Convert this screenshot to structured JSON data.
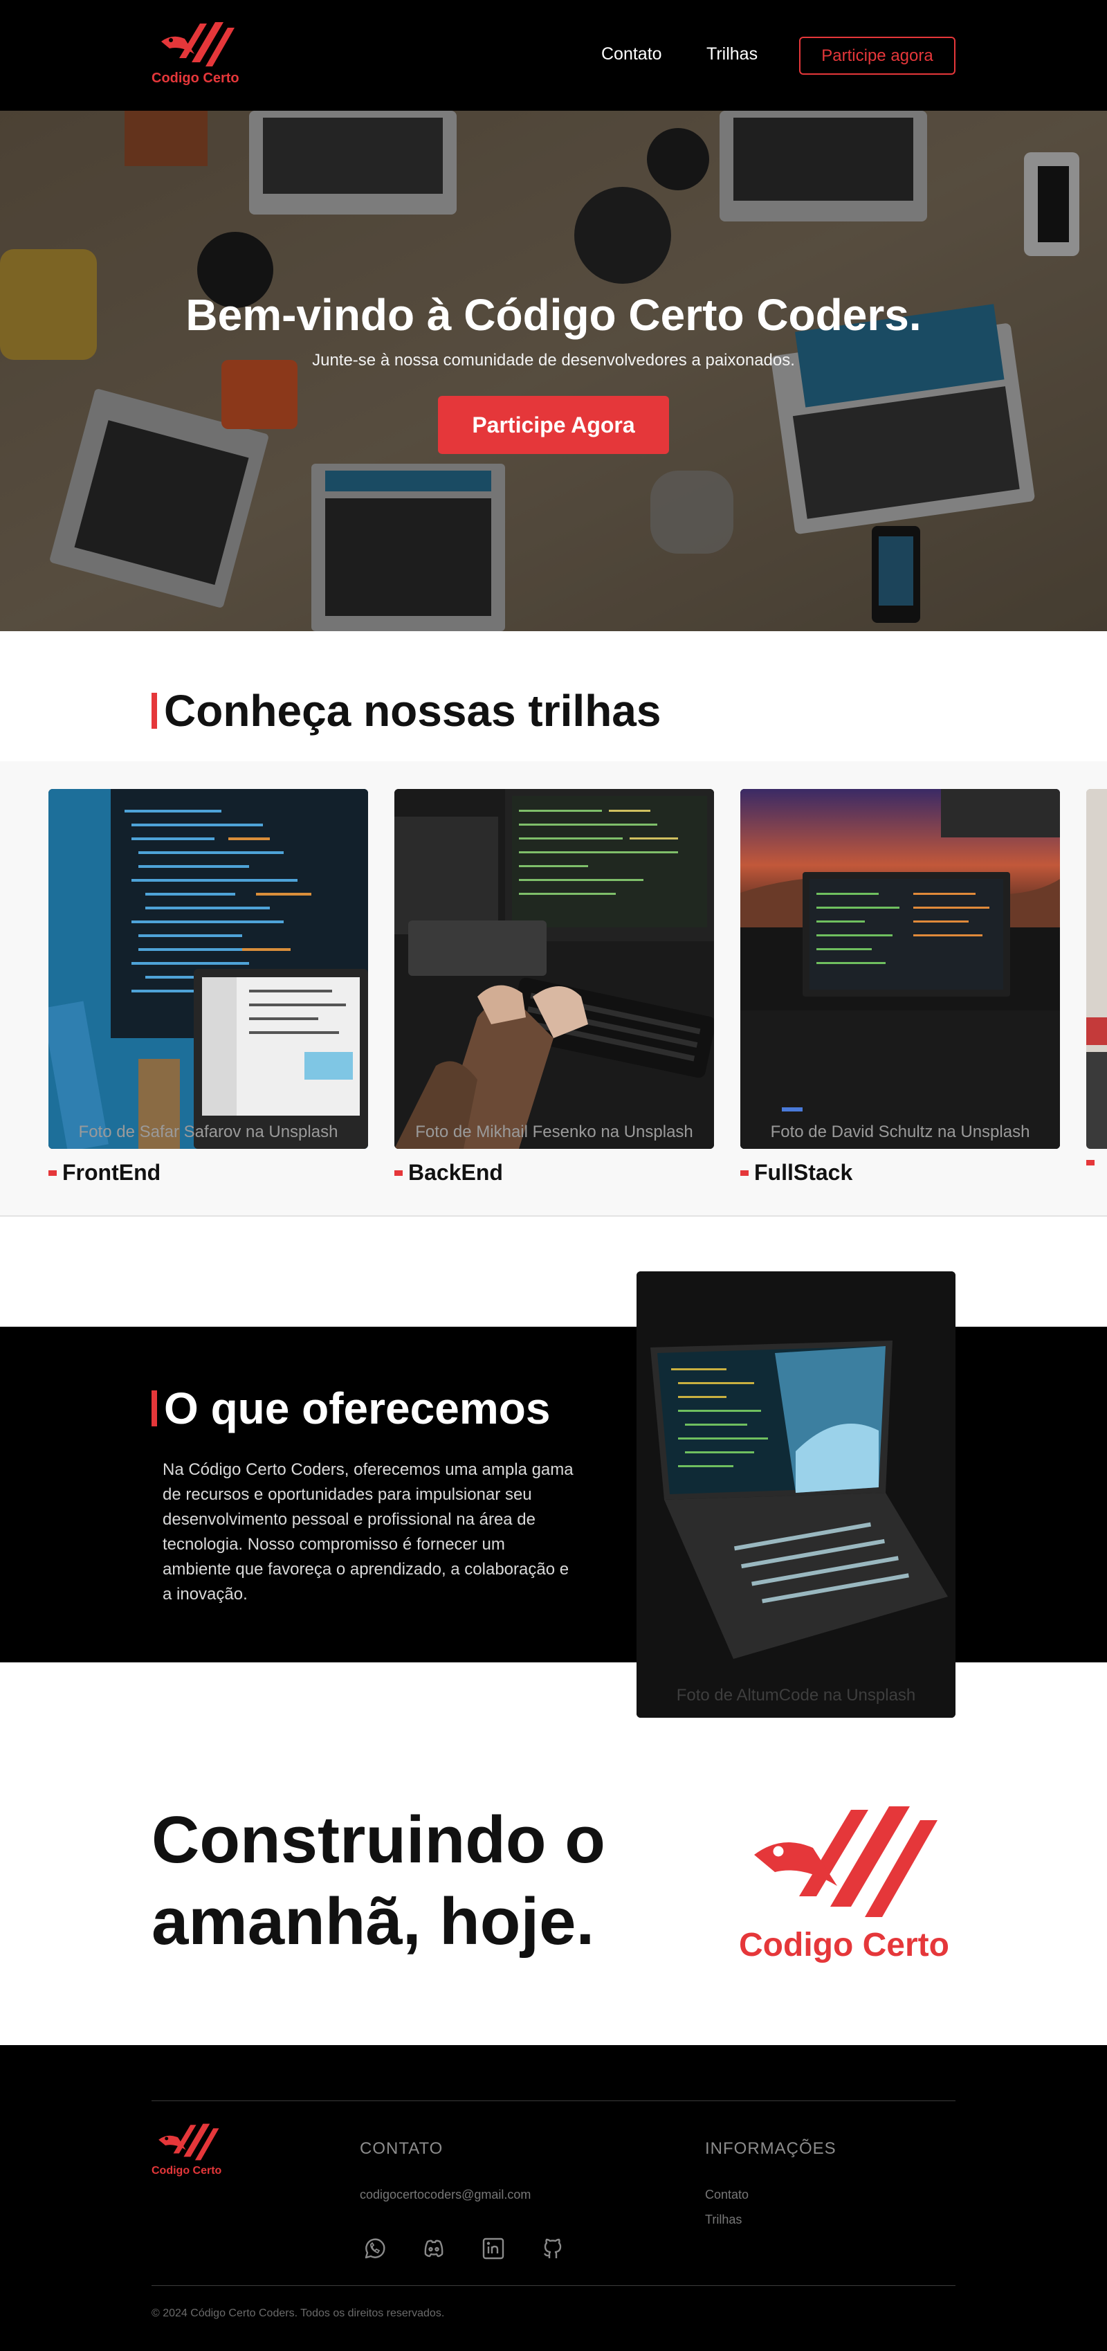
{
  "colors": {
    "brand_red": "#e5373a",
    "header_bg": "#000000",
    "footer_bg": "#000000"
  },
  "header": {
    "logo_text": "Codigo Certo",
    "nav": [
      {
        "label": "Contato"
      },
      {
        "label": "Trilhas"
      }
    ],
    "cta_label": "Participe agora"
  },
  "hero": {
    "title": "Bem-vindo à Código Certo Coders.",
    "subtitle": "Junte-se à nossa comunidade de desenvolvedores a paixonados.",
    "cta_label": "Participe Agora"
  },
  "tracks": {
    "title": "Conheça nossas trilhas",
    "items": [
      {
        "label": "FrontEnd",
        "credit": "Foto de Safar Safarov na Unsplash"
      },
      {
        "label": "BackEnd",
        "credit": "Foto de Mikhail Fesenko na Unsplash"
      },
      {
        "label": "FullStack",
        "credit": "Foto de David Schultz na Unsplash"
      }
    ]
  },
  "offer": {
    "title": "O que oferecemos",
    "text": "Na Código Certo Coders, oferecemos uma ampla gama de recursos e oportunidades para impulsionar seu desenvolvimento pessoal e profissional na área de tecnologia. Nosso compromisso é fornecer um ambiente que favoreça o aprendizado, a colaboração e a inovação.",
    "image_credit": "Foto de AltumCode na Unsplash"
  },
  "build": {
    "line1": "Construindo o",
    "line2": "amanhã, hoje.",
    "logo_text": "Codigo Certo"
  },
  "footer": {
    "logo_text": "Codigo Certo",
    "contato_heading": "CONTATO",
    "email": "codigocertocoders@gmail.com",
    "social_icons": [
      "whatsapp-icon",
      "discord-icon",
      "linkedin-icon",
      "github-icon"
    ],
    "info_heading": "INFORMAÇÕES",
    "links": [
      {
        "label": "Contato"
      },
      {
        "label": "Trilhas"
      }
    ],
    "copyright": "© 2024 Código Certo Coders. Todos os direitos reservados."
  }
}
